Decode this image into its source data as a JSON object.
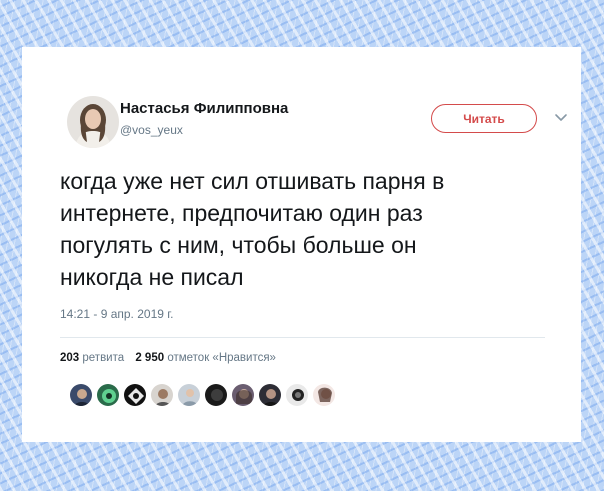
{
  "tweet": {
    "author_name": "Настасья Филипповна",
    "author_handle": "@vos_yeux",
    "follow_label": "Читать",
    "text": "когда уже нет сил отшивать парня в\nинтернете, предпочитаю один раз\nпогулять с ним, чтобы больше он\nникогда не писал",
    "timestamp": "14:21 - 9 апр. 2019 г.",
    "retweets_count": "203",
    "retweets_label": "ретвита",
    "likes_count": "2 950",
    "likes_label": "отметок «Нравится»"
  },
  "colors": {
    "accent": "#d44b4b",
    "text_primary": "#14171a",
    "text_secondary": "#657786",
    "divider": "#e1e8ed"
  },
  "icons": {
    "more_menu": "chevron-down-icon"
  }
}
